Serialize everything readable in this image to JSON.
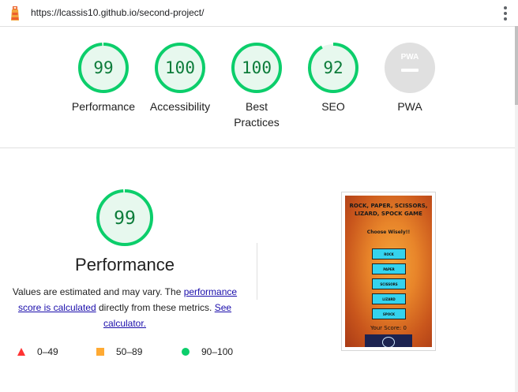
{
  "browser": {
    "url": "https://lcassis10.github.io/second-project/",
    "icon": "lighthouse-icon",
    "menu_icon": "kebab-menu-icon"
  },
  "gauges": [
    {
      "score": "99",
      "label": "Performance",
      "value": 99
    },
    {
      "score": "100",
      "label": "Accessibility",
      "value": 100
    },
    {
      "score": "100",
      "label": "Best Practices",
      "value": 100
    },
    {
      "score": "92",
      "label": "SEO",
      "value": 92
    },
    {
      "score": "",
      "label": "PWA",
      "badge": "PWA",
      "value": null
    }
  ],
  "detail": {
    "score": "99",
    "score_value": 99,
    "title": "Performance",
    "desc_1": "Values are estimated and may vary. The ",
    "link_1": "performance score is calculated",
    "desc_2": " directly from these metrics. ",
    "link_2": "See calculator."
  },
  "legend": [
    {
      "range": "0–49",
      "shape": "triangle",
      "color": "#ff3333"
    },
    {
      "range": "50–89",
      "shape": "square",
      "color": "#ffaa33"
    },
    {
      "range": "90–100",
      "shape": "circle",
      "color": "#0cce6b"
    }
  ],
  "colors": {
    "pass_ring": "#0cce6b",
    "pass_fill": "#e7f8ee",
    "pass_text": "#0c7c3a",
    "pwa_gray": "#e0e0e0"
  },
  "thumbnail": {
    "title": "ROCK, PAPER, SCISSORS, LIZARD, SPOCK GAME",
    "subtitle": "Choose Wisely!!",
    "buttons": [
      "ROCK",
      "PAPER",
      "SCISSORS",
      "LIZARD",
      "SPOCK"
    ],
    "score": "Your Score: 0"
  }
}
